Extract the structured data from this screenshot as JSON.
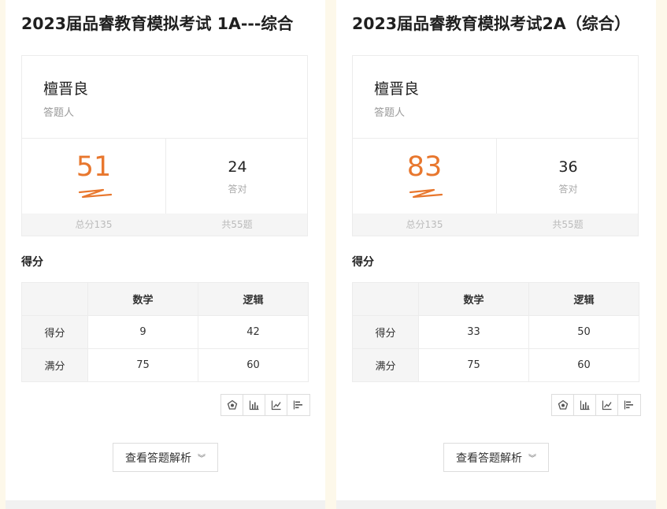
{
  "panels": [
    {
      "title": "2023届品睿教育模拟考试 1A---综合",
      "name": "檀晋良",
      "name_label": "答题人",
      "score": "51",
      "correct": "24",
      "correct_label": "答对",
      "total_score": "总分135",
      "total_questions": "共55题",
      "section_title": "得分",
      "table": {
        "columns": [
          "",
          "数学",
          "逻辑"
        ],
        "rows": [
          {
            "label": "得分",
            "values": [
              "9",
              "42"
            ]
          },
          {
            "label": "满分",
            "values": [
              "75",
              "60"
            ]
          }
        ]
      },
      "view_button": "查看答题解析"
    },
    {
      "title": "2023届品睿教育模拟考试2A（综合）",
      "name": "檀晋良",
      "name_label": "答题人",
      "score": "83",
      "correct": "36",
      "correct_label": "答对",
      "total_score": "总分135",
      "total_questions": "共55题",
      "section_title": "得分",
      "table": {
        "columns": [
          "",
          "数学",
          "逻辑"
        ],
        "rows": [
          {
            "label": "得分",
            "values": [
              "33",
              "50"
            ]
          },
          {
            "label": "满分",
            "values": [
              "75",
              "60"
            ]
          }
        ]
      },
      "view_button": "查看答题解析"
    }
  ],
  "chart_icons": [
    "radar-chart-icon",
    "bar-chart-icon",
    "line-chart-icon",
    "horizontal-bar-chart-icon"
  ],
  "colors": {
    "score": "#e8772e",
    "background": "#fdf8ea"
  }
}
